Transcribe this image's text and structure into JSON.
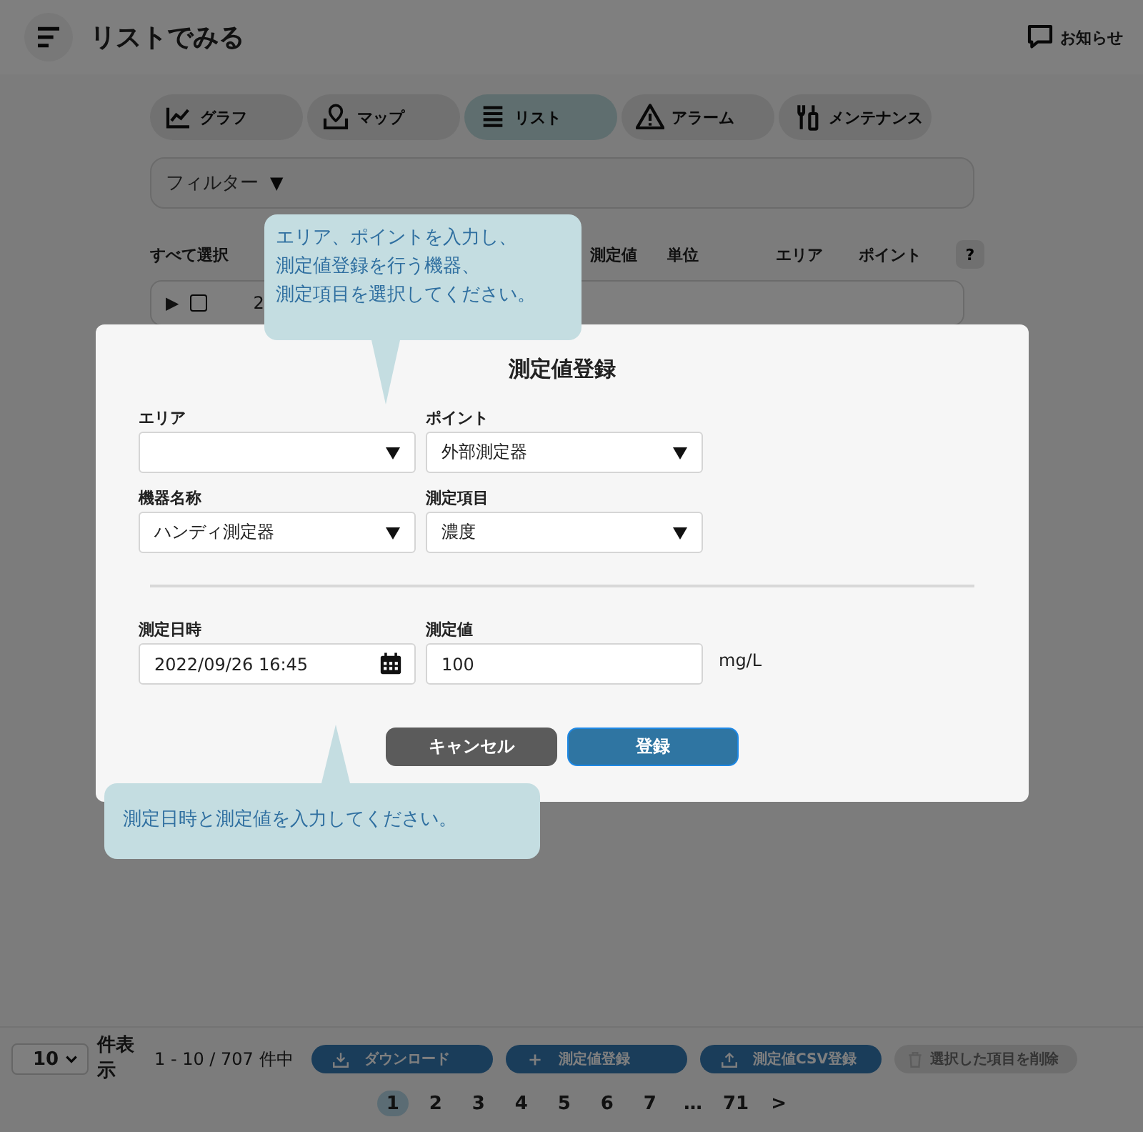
{
  "header": {
    "title": "リストでみる",
    "notice": "お知らせ"
  },
  "tabs": [
    {
      "label": "グラフ",
      "kind": "chart",
      "selected": false
    },
    {
      "label": "マップ",
      "kind": "map",
      "selected": false
    },
    {
      "label": "リスト",
      "kind": "list",
      "selected": true
    },
    {
      "label": "アラーム",
      "kind": "alarm",
      "selected": false
    },
    {
      "label": "メンテナンス",
      "kind": "tools",
      "selected": false
    }
  ],
  "filter": {
    "label": "フィルター",
    "toggle": "▼"
  },
  "table": {
    "columns": [
      "すべて選択",
      "測定値",
      "単位",
      "エリア",
      "ポイント"
    ],
    "help": "?",
    "rows": [
      {
        "expander": "▶",
        "checked": false,
        "column_2": "2"
      }
    ]
  },
  "modal": {
    "title": "測定値登録",
    "fields": [
      {
        "label": "エリア",
        "kind": "select"
      },
      {
        "label": "ポイント",
        "kind": "select",
        "value": "外部測定器"
      },
      {
        "label": "機器名称",
        "kind": "select",
        "value": "ハンディ測定器"
      },
      {
        "label": "測定項目",
        "kind": "select",
        "value": "濃度"
      },
      {
        "label": "測定日時",
        "kind": "date",
        "value": "2022/09/26 16:45"
      },
      {
        "label": "測定値",
        "kind": "text",
        "value": "100",
        "unit": "mg/L"
      }
    ],
    "buttons": [
      {
        "label": "キャンセル",
        "kind": "cancel"
      },
      {
        "label": "登録",
        "kind": "primary"
      }
    ]
  },
  "tips": [
    {
      "lines": [
        "エリア、ポイントを入力し、",
        "測定値登録を行う機器、",
        "測定項目を選択してください。"
      ],
      "kind": "down"
    },
    {
      "lines": [
        "測定日時と測定値を入力してください。"
      ],
      "kind": "up"
    }
  ],
  "footer": {
    "page_size": "10",
    "page_size_label": "件表示",
    "range": "1 - 10 / 707 件中",
    "actions": [
      {
        "label": "ダウンロード",
        "kind": "download",
        "disabled": false
      },
      {
        "label": "測定値登録",
        "kind": "add",
        "disabled": false
      },
      {
        "label": "測定値CSV登録",
        "kind": "upload",
        "disabled": false
      },
      {
        "label": "選択した項目を削除",
        "kind": "delete",
        "disabled": true
      }
    ],
    "pages": [
      {
        "label": "1",
        "selected": true
      },
      {
        "label": "2",
        "selected": false
      },
      {
        "label": "3",
        "selected": false
      },
      {
        "label": "4",
        "selected": false
      },
      {
        "label": "5",
        "selected": false
      },
      {
        "label": "6",
        "selected": false
      },
      {
        "label": "7",
        "selected": false
      },
      {
        "label": "…",
        "selected": false
      },
      {
        "label": "71",
        "selected": false
      }
    ],
    "next": ">"
  }
}
